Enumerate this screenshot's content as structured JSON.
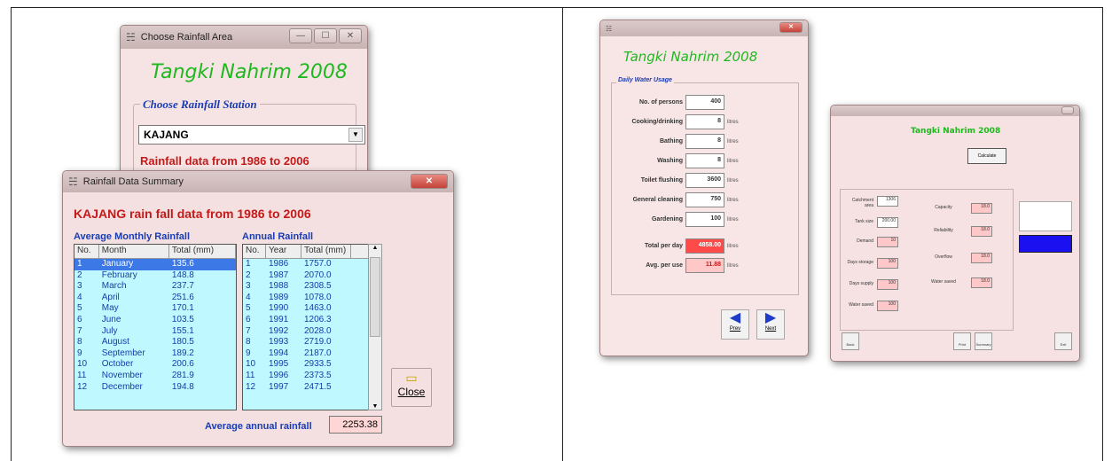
{
  "choose_window": {
    "title": "Choose Rainfall Area",
    "app_title": "Tangki Nahrim 2008",
    "station_group_label": "Choose Rainfall Station",
    "station_value": "KAJANG",
    "rainfall_range_text": "Rainfall data from 1986 to 2006"
  },
  "summary_window": {
    "title": "Rainfall Data Summary",
    "heading": "KAJANG rain fall data from 1986 to 2006",
    "monthly_label": "Average Monthly Rainfall",
    "annual_label": "Annual Rainfall",
    "monthly_headers": [
      "No.",
      "Month",
      "Total (mm)"
    ],
    "annual_headers": [
      "No.",
      "Year",
      "Total (mm)"
    ],
    "monthly_rows": [
      {
        "no": "1",
        "month": "January",
        "total": "135.6"
      },
      {
        "no": "2",
        "month": "February",
        "total": "148.8"
      },
      {
        "no": "3",
        "month": "March",
        "total": "237.7"
      },
      {
        "no": "4",
        "month": "April",
        "total": "251.6"
      },
      {
        "no": "5",
        "month": "May",
        "total": "170.1"
      },
      {
        "no": "6",
        "month": "June",
        "total": "103.5"
      },
      {
        "no": "7",
        "month": "July",
        "total": "155.1"
      },
      {
        "no": "8",
        "month": "August",
        "total": "180.5"
      },
      {
        "no": "9",
        "month": "September",
        "total": "189.2"
      },
      {
        "no": "10",
        "month": "October",
        "total": "200.6"
      },
      {
        "no": "11",
        "month": "November",
        "total": "281.9"
      },
      {
        "no": "12",
        "month": "December",
        "total": "194.8"
      }
    ],
    "annual_rows": [
      {
        "no": "1",
        "year": "1986",
        "total": "1757.0"
      },
      {
        "no": "2",
        "year": "1987",
        "total": "2070.0"
      },
      {
        "no": "3",
        "year": "1988",
        "total": "2308.5"
      },
      {
        "no": "4",
        "year": "1989",
        "total": "1078.0"
      },
      {
        "no": "5",
        "year": "1990",
        "total": "1463.0"
      },
      {
        "no": "6",
        "year": "1991",
        "total": "1206.3"
      },
      {
        "no": "7",
        "year": "1992",
        "total": "2028.0"
      },
      {
        "no": "8",
        "year": "1993",
        "total": "2719.0"
      },
      {
        "no": "9",
        "year": "1994",
        "total": "2187.0"
      },
      {
        "no": "10",
        "year": "1995",
        "total": "2933.5"
      },
      {
        "no": "11",
        "year": "1996",
        "total": "2373.5"
      },
      {
        "no": "12",
        "year": "1997",
        "total": "2471.5"
      }
    ],
    "close_label": "Close",
    "average_label": "Average annual rainfall",
    "average_value": "2253.38"
  },
  "usage_window": {
    "app_title": "Tangki Nahrim 2008",
    "group_label": "Daily Water Usage",
    "rows": [
      {
        "label": "No. of persons",
        "value": "400",
        "unit": ""
      },
      {
        "label": "Cooking/drinking",
        "value": "8",
        "unit": "litres"
      },
      {
        "label": "Bathing",
        "value": "8",
        "unit": "litres"
      },
      {
        "label": "Washing",
        "value": "8",
        "unit": "litres"
      },
      {
        "label": "Toilet flushing",
        "value": "3600",
        "unit": "litres"
      },
      {
        "label": "General cleaning",
        "value": "750",
        "unit": "litres"
      },
      {
        "label": "Gardening",
        "value": "100",
        "unit": "litres"
      },
      {
        "label": "Total per day",
        "value": "4858.00",
        "unit": "litres"
      },
      {
        "label": "Avg. per use",
        "value": "11.88",
        "unit": "litres"
      }
    ],
    "prev_label": "Prev",
    "next_label": "Next"
  },
  "result_window": {
    "app_title": "Tangki Nahrim 2008",
    "left_labels": [
      "Catchment area",
      "Tank size",
      "Demand",
      "Days storage",
      "Days supply",
      "Water saved"
    ],
    "left_values": [
      "1306",
      "200.00",
      "10",
      "100",
      "100",
      "100"
    ],
    "right_labels": [
      "Capacity",
      "Reliability",
      "Overflow",
      "Water saved"
    ],
    "right_values": [
      "18.0",
      "18.0",
      "18.0",
      "18.0"
    ],
    "calc_label": "Calculate",
    "bottom_buttons": [
      "Back",
      "Print",
      "Summary",
      "Exit"
    ]
  }
}
